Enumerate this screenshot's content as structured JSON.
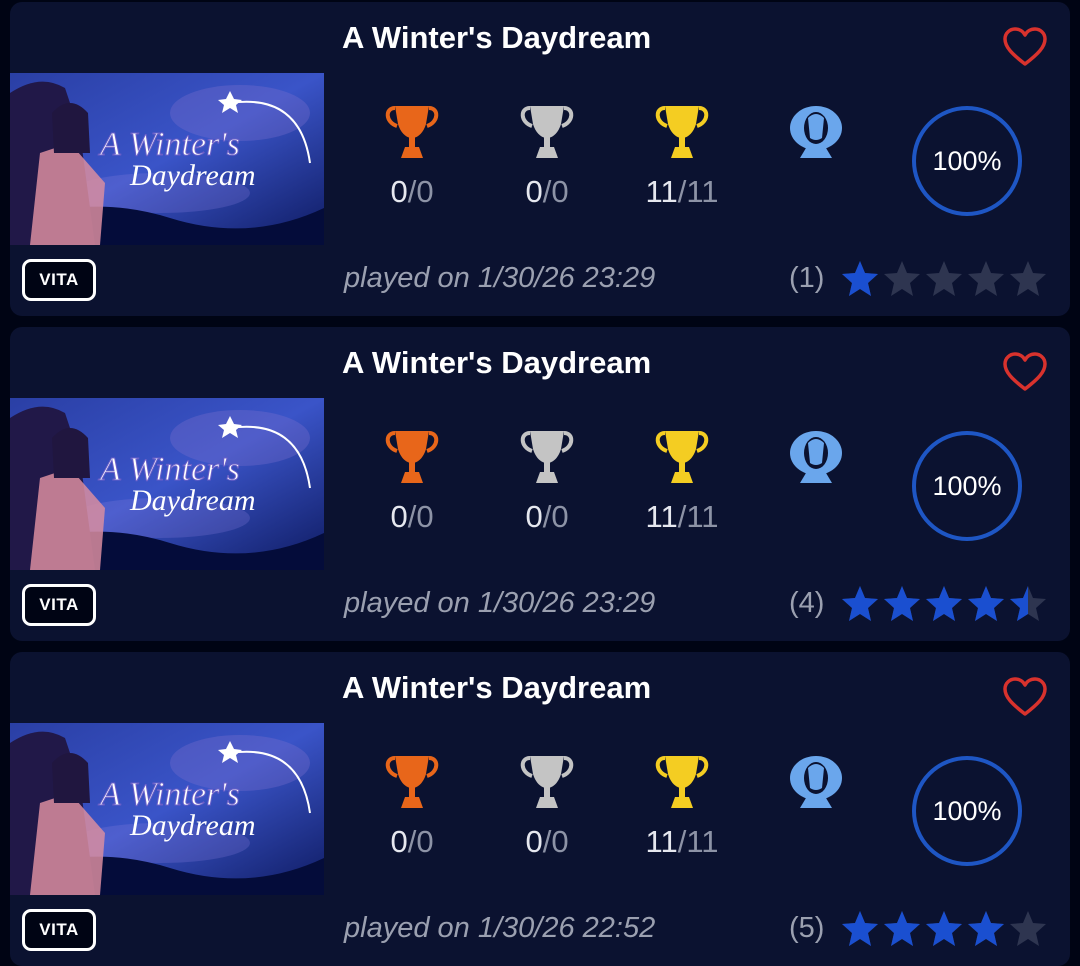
{
  "games": [
    {
      "title": "A Winter's Daydream",
      "cover_art": {
        "alt": "A Winter's Daydream",
        "logo_line1": "A Winter's",
        "logo_line2": "Daydream"
      },
      "platform": "VITA",
      "favorite_icon": "heart-outline-icon",
      "trophies": {
        "bronze": {
          "earned": "0",
          "sep": "/",
          "total": "0"
        },
        "silver": {
          "earned": "0",
          "sep": "/",
          "total": "0"
        },
        "gold": {
          "earned": "11",
          "sep": "/",
          "total": "11"
        },
        "platinum": {
          "earned": "",
          "total": ""
        }
      },
      "progress": 100,
      "progress_label": "100%",
      "played": "played on 1/30/26 23:29",
      "rating_count": "(1)",
      "rating": 1
    },
    {
      "title": "A Winter's Daydream",
      "cover_art": {
        "alt": "A Winter's Daydream",
        "logo_line1": "A Winter's",
        "logo_line2": "Daydream"
      },
      "platform": "VITA",
      "favorite_icon": "heart-outline-icon",
      "trophies": {
        "bronze": {
          "earned": "0",
          "sep": "/",
          "total": "0"
        },
        "silver": {
          "earned": "0",
          "sep": "/",
          "total": "0"
        },
        "gold": {
          "earned": "11",
          "sep": "/",
          "total": "11"
        },
        "platinum": {
          "earned": "",
          "total": ""
        }
      },
      "progress": 100,
      "progress_label": "100%",
      "played": "played on 1/30/26 23:29",
      "rating_count": "(4)",
      "rating": 4.5
    },
    {
      "title": "A Winter's Daydream",
      "cover_art": {
        "alt": "A Winter's Daydream",
        "logo_line1": "A Winter's",
        "logo_line2": "Daydream"
      },
      "platform": "VITA",
      "favorite_icon": "heart-outline-icon",
      "trophies": {
        "bronze": {
          "earned": "0",
          "sep": "/",
          "total": "0"
        },
        "silver": {
          "earned": "0",
          "sep": "/",
          "total": "0"
        },
        "gold": {
          "earned": "11",
          "sep": "/",
          "total": "11"
        },
        "platinum": {
          "earned": "",
          "total": ""
        }
      },
      "progress": 100,
      "progress_label": "100%",
      "played": "played on 1/30/26 22:52",
      "rating_count": "(5)",
      "rating": 4
    }
  ],
  "colors": {
    "background": "#000414",
    "card": "#0b1230",
    "bronze": "#e8661a",
    "silver": "#c4c4c4",
    "gold": "#f4cd22",
    "platinum": "#6aa6ec",
    "progress_ring": "#1e56c4",
    "star_filled": "#1a4fd0",
    "star_empty": "#2e3550",
    "heart": "#d8322d"
  }
}
